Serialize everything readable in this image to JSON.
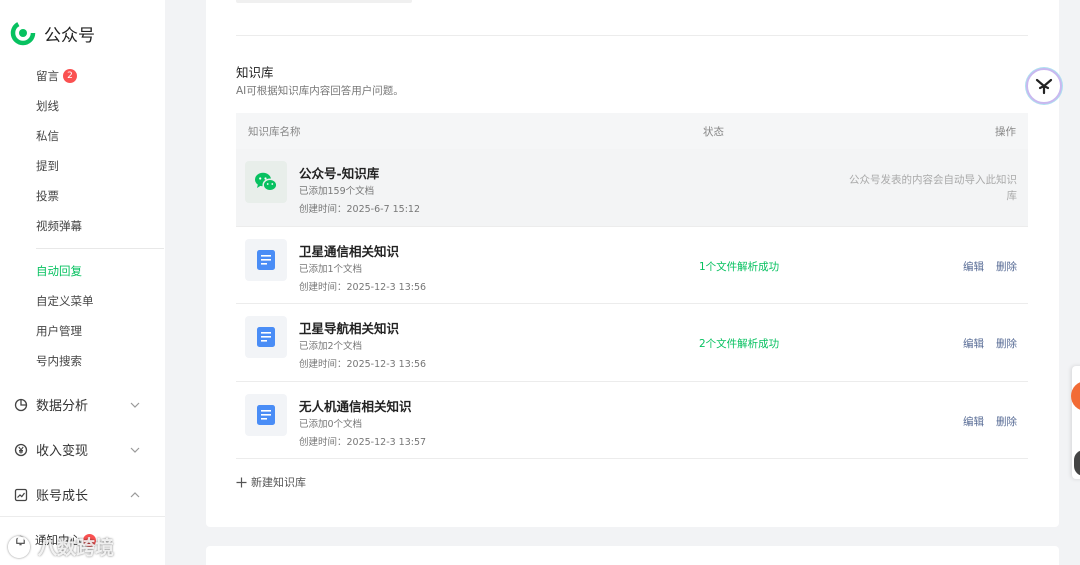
{
  "sidebar": {
    "brand": "公众号",
    "items": [
      {
        "label": "留言",
        "badge": "2"
      },
      {
        "label": "划线"
      },
      {
        "label": "私信"
      },
      {
        "label": "提到"
      },
      {
        "label": "投票"
      },
      {
        "label": "视频弹幕"
      },
      {
        "label": "自动回复",
        "active": true
      },
      {
        "label": "自定义菜单"
      },
      {
        "label": "用户管理"
      },
      {
        "label": "号内搜索"
      }
    ],
    "groups": [
      {
        "label": "数据分析",
        "icon": "pie-chart-icon",
        "expanded": false
      },
      {
        "label": "收入变现",
        "icon": "yen-icon",
        "expanded": false
      },
      {
        "label": "账号成长",
        "icon": "growth-icon",
        "expanded": true
      }
    ],
    "notice": {
      "label": "通知中心",
      "badge": "1"
    },
    "watermark": "八数跨境"
  },
  "knowledge": {
    "title": "知识库",
    "description": "AI可根据知识库内容回答用户问题。",
    "columns": {
      "name": "知识库名称",
      "status": "状态",
      "actions": "操作"
    },
    "rows": [
      {
        "name": "公众号-知识库",
        "docs": "已添加159个文档",
        "created": "创建时间：2025-6-7 15:12",
        "status": "",
        "note": "公众号发表的内容会自动导入此知识库",
        "icon": "wechat-icon",
        "highlight": true
      },
      {
        "name": "卫星通信相关知识",
        "docs": "已添加1个文档",
        "created": "创建时间：2025-12-3 13:56",
        "status": "1个文件解析成功",
        "edit": "编辑",
        "delete": "删除",
        "icon": "document-icon"
      },
      {
        "name": "卫星导航相关知识",
        "docs": "已添加2个文档",
        "created": "创建时间：2025-12-3 13:56",
        "status": "2个文件解析成功",
        "edit": "编辑",
        "delete": "删除",
        "icon": "document-icon"
      },
      {
        "name": "无人机通信相关知识",
        "docs": "已添加0个文档",
        "created": "创建时间：2025-12-3 13:57",
        "status": "",
        "edit": "编辑",
        "delete": "删除",
        "icon": "document-icon"
      }
    ],
    "new_button": "新建知识库"
  },
  "colors": {
    "accent": "#07c160",
    "link": "#576b95",
    "badge": "#fa5151"
  }
}
